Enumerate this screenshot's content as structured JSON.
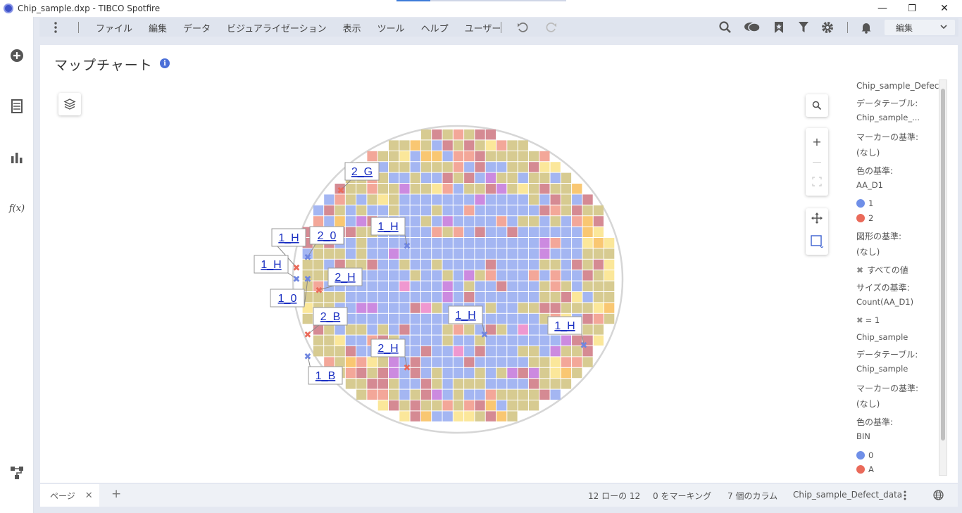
{
  "window": {
    "title": "Chip_sample.dxp - TIBCO Spotfire",
    "minimize": "—",
    "restore": "❐",
    "close": "✕"
  },
  "toolbar": {
    "menu": [
      "ファイル",
      "編集",
      "データ",
      "ビジュアライゼーション",
      "表示",
      "ツール",
      "ヘルプ",
      "ユーザー"
    ],
    "mode": "編集"
  },
  "visualization": {
    "title": "マップチャート",
    "info": "i"
  },
  "colors": {
    "blue": "#a4b6f2",
    "khaki": "#d7cb91",
    "rose": "#d58a93",
    "salmon": "#f3a799",
    "purple": "#cc8ae0",
    "pink": "#ef98d0",
    "orange": "#f9c772",
    "yellow": "#fbe79a",
    "teal": "#86d6b8",
    "marker_blue": "#6f86e0",
    "marker_red": "#ea6a5a"
  },
  "wafer_labels": [
    {
      "id": "l1",
      "text": "2_G"
    },
    {
      "id": "l2",
      "text": "2_0"
    },
    {
      "id": "l3",
      "text": "1_H"
    },
    {
      "id": "l4",
      "text": "1_H"
    },
    {
      "id": "l5",
      "text": "1_H"
    },
    {
      "id": "l6",
      "text": "2_H"
    },
    {
      "id": "l7",
      "text": "1_0"
    },
    {
      "id": "l8",
      "text": "2_B"
    },
    {
      "id": "l9",
      "text": "1_H"
    },
    {
      "id": "l10",
      "text": "1_H"
    },
    {
      "id": "l11",
      "text": "2_H"
    },
    {
      "id": "l12",
      "text": "1_B"
    }
  ],
  "legend": {
    "layer1_title": "Chip_sample_Defect_data",
    "data_table_label": "データテーブル:",
    "layer1_table": "Chip_sample_...",
    "marker_by_label": "マーカーの基準:",
    "none": "(なし)",
    "color_by_label": "色の基準:",
    "layer1_color_col": "AA_D1",
    "layer1_values": [
      "1",
      "2"
    ],
    "shape_by_label": "図形の基準:",
    "all_values": "すべての値",
    "size_by_label": "サイズの基準:",
    "size_col": "Count(AA_D1)",
    "size_value": "= 1",
    "layer2_title": "Chip_sample",
    "layer2_table": "Chip_sample",
    "layer2_color_col": "BIN",
    "layer2_values": [
      "0",
      "A"
    ]
  },
  "statusbar": {
    "page_tab": "ページ",
    "add": "+",
    "rows": "12 ローの 12",
    "marked": "0 をマーキング",
    "columns": "7 個のカラム",
    "table": "Chip_sample_Defect_data"
  }
}
